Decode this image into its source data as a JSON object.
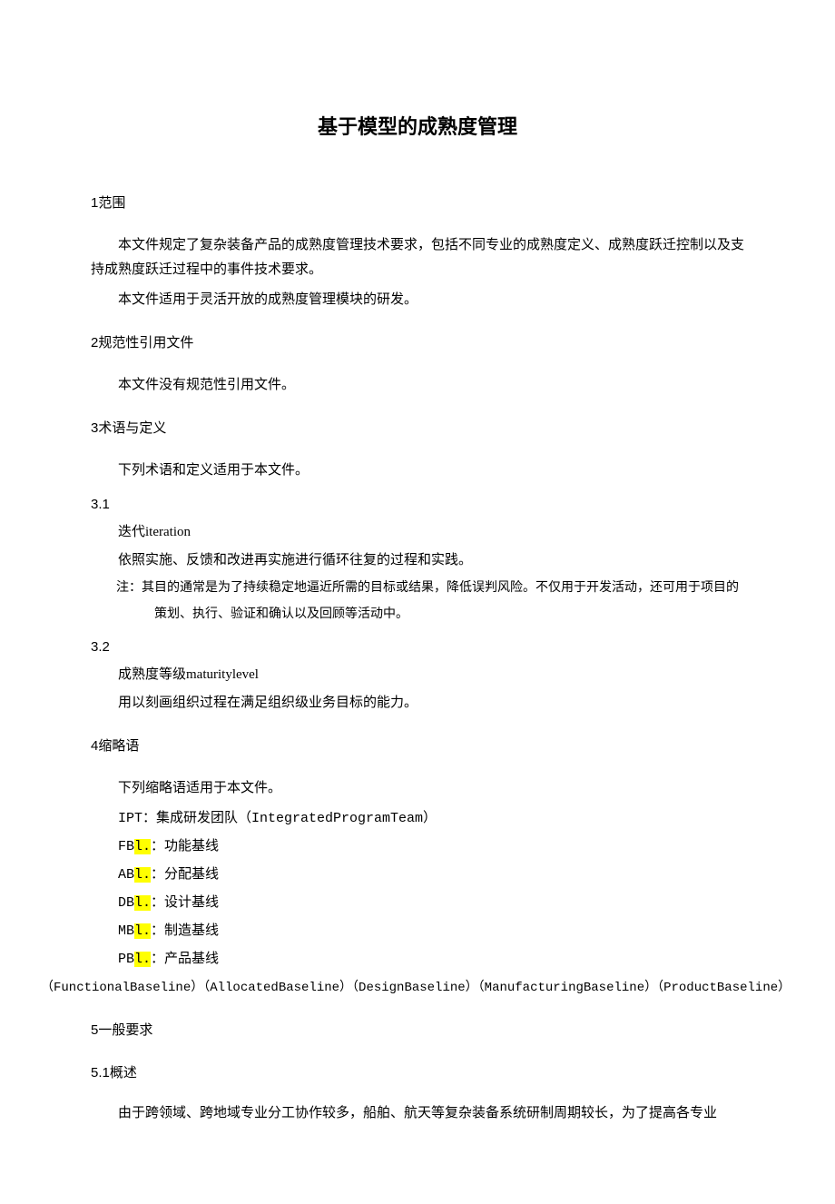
{
  "title": "基于模型的成熟度管理",
  "s1": {
    "heading": "1范围",
    "p1": "本文件规定了复杂装备产品的成熟度管理技术要求，包括不同专业的成熟度定义、成熟度跃迁控制以及支持成熟度跃迁过程中的事件技术要求。",
    "p2": "本文件适用于灵活开放的成熟度管理模块的研发。"
  },
  "s2": {
    "heading": "2规范性引用文件",
    "p1": "本文件没有规范性引用文件。"
  },
  "s3": {
    "heading": "3术语与定义",
    "p1": "下列术语和定义适用于本文件。",
    "t1": {
      "num": "3.1",
      "title": "迭代iteration",
      "def": "依照实施、反馈和改进再实施进行循环往复的过程和实践。",
      "note1": "注：其目的通常是为了持续稳定地逼近所需的目标或结果，降低误判风险。不仅用于开发活动，还可用于项目的",
      "note2": "策划、执行、验证和确认以及回顾等活动中。"
    },
    "t2": {
      "num": "3.2",
      "title": "成熟度等级maturitylevel",
      "def": "用以刻画组织过程在满足组织级业务目标的能力。"
    }
  },
  "s4": {
    "heading": "4缩略语",
    "p1": "下列缩略语适用于本文件。",
    "ipt": "IPT：集成研发团队（IntegratedProgramTeam）",
    "fb_pre": "FB",
    "fb_hl": "l.",
    "fb_post": "：功能基线",
    "ab_pre": "AB",
    "ab_hl": "l.",
    "ab_post": "：分配基线",
    "db_pre": "DB",
    "db_hl": "l.",
    "db_post": "：设计基线",
    "mb_pre": "MB",
    "mb_hl": "l.",
    "mb_post": "：制造基线",
    "pb_pre": "PB",
    "pb_hl": "l.",
    "pb_post": "：产品基线",
    "fullnames": "（FunctionalBaseline）（AllocatedBaseline）（DesignBaseline）（ManufacturingBaseline）（ProductBaseline）"
  },
  "s5": {
    "heading": "5一般要求",
    "sub1": "5.1概述",
    "p1": "由于跨领域、跨地域专业分工协作较多，船舶、航天等复杂装备系统研制周期较长，为了提高各专业"
  }
}
